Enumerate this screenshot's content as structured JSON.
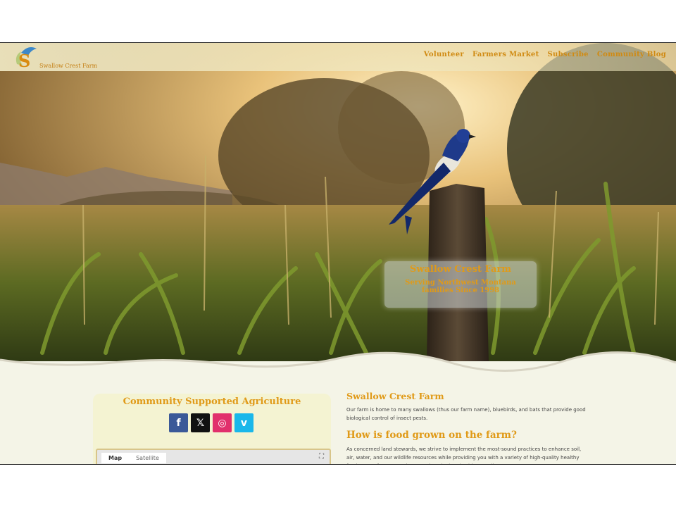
{
  "header": {
    "logo_letter": "S",
    "logo_text": "Swallow Crest Farm",
    "nav": [
      "Volunteer",
      "Farmers Market",
      "Subscribe",
      "Community Blog"
    ]
  },
  "hero": {
    "title": "Swallow Crest Farm",
    "subtitle": "Serving Northwest Montana families Since 1998"
  },
  "csa": {
    "title": "Community Supported Agriculture",
    "social": [
      {
        "name": "facebook-icon",
        "glyph": "f",
        "color": "#3b5998"
      },
      {
        "name": "x-icon",
        "glyph": "𝕏",
        "color": "#111111"
      },
      {
        "name": "instagram-icon",
        "glyph": "◎",
        "color": "#e1306c"
      },
      {
        "name": "vimeo-icon",
        "glyph": "v",
        "color": "#1ab7ea"
      }
    ],
    "map_tabs": [
      "Map",
      "Satellite"
    ],
    "fullscreen_glyph": "⛶"
  },
  "main": {
    "heading1": "Swallow Crest Farm",
    "para1": "Our farm is home to many swallows (thus our farm name), bluebirds, and bats that provide good biological control of insect pests.",
    "heading2": "How is food grown on the farm?",
    "para2": "As concerned land stewards, we strive to implement the most-sound practices to enhance soil, air, water, and our wildlife resources while providing you with a variety of high-quality healthy food. Most of our operations are done by hand, with a small"
  },
  "colors": {
    "accent": "#e09a18",
    "card": "#f4f3d2",
    "background": "#f4f4e7"
  }
}
